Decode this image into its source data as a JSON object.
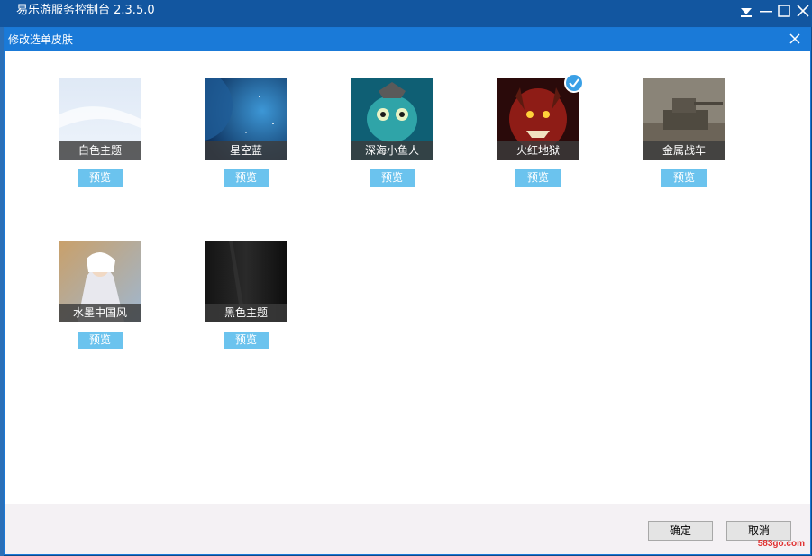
{
  "main_window": {
    "title": "易乐游服务控制台 2.3.5.0"
  },
  "dialog": {
    "title": "修改选单皮肤",
    "skins": [
      {
        "name": "白色主题",
        "preview_label": "预览",
        "selected": false
      },
      {
        "name": "星空蓝",
        "preview_label": "预览",
        "selected": false
      },
      {
        "name": "深海小鱼人",
        "preview_label": "预览",
        "selected": false
      },
      {
        "name": "火红地狱",
        "preview_label": "预览",
        "selected": true
      },
      {
        "name": "金属战车",
        "preview_label": "预览",
        "selected": false
      },
      {
        "name": "水墨中国风",
        "preview_label": "预览",
        "selected": false
      },
      {
        "name": "黑色主题",
        "preview_label": "预览",
        "selected": false
      }
    ],
    "ok_label": "确定",
    "cancel_label": "取消"
  },
  "watermark": {
    "text": "583go.com"
  },
  "colors": {
    "title_bar": "#1256a0",
    "dialog_title_bar": "#1a7ad8",
    "preview_button": "#6bc3ee",
    "selected_check": "#3aa0e6"
  }
}
